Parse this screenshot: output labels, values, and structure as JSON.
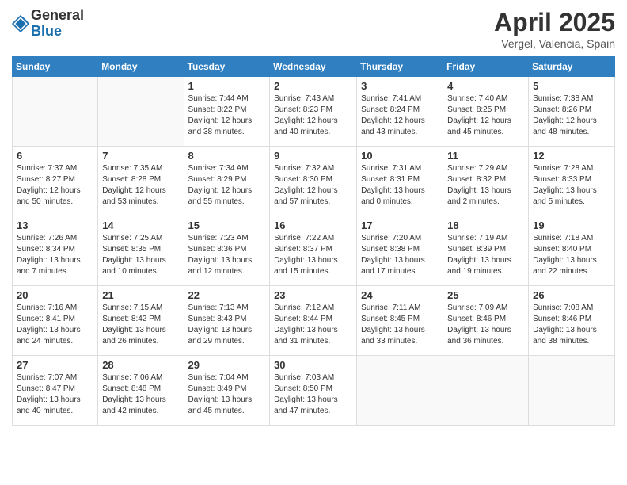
{
  "logo": {
    "general": "General",
    "blue": "Blue"
  },
  "title": "April 2025",
  "location": "Vergel, Valencia, Spain",
  "days_of_week": [
    "Sunday",
    "Monday",
    "Tuesday",
    "Wednesday",
    "Thursday",
    "Friday",
    "Saturday"
  ],
  "weeks": [
    [
      {
        "day": "",
        "info": ""
      },
      {
        "day": "",
        "info": ""
      },
      {
        "day": "1",
        "info": "Sunrise: 7:44 AM\nSunset: 8:22 PM\nDaylight: 12 hours\nand 38 minutes."
      },
      {
        "day": "2",
        "info": "Sunrise: 7:43 AM\nSunset: 8:23 PM\nDaylight: 12 hours\nand 40 minutes."
      },
      {
        "day": "3",
        "info": "Sunrise: 7:41 AM\nSunset: 8:24 PM\nDaylight: 12 hours\nand 43 minutes."
      },
      {
        "day": "4",
        "info": "Sunrise: 7:40 AM\nSunset: 8:25 PM\nDaylight: 12 hours\nand 45 minutes."
      },
      {
        "day": "5",
        "info": "Sunrise: 7:38 AM\nSunset: 8:26 PM\nDaylight: 12 hours\nand 48 minutes."
      }
    ],
    [
      {
        "day": "6",
        "info": "Sunrise: 7:37 AM\nSunset: 8:27 PM\nDaylight: 12 hours\nand 50 minutes."
      },
      {
        "day": "7",
        "info": "Sunrise: 7:35 AM\nSunset: 8:28 PM\nDaylight: 12 hours\nand 53 minutes."
      },
      {
        "day": "8",
        "info": "Sunrise: 7:34 AM\nSunset: 8:29 PM\nDaylight: 12 hours\nand 55 minutes."
      },
      {
        "day": "9",
        "info": "Sunrise: 7:32 AM\nSunset: 8:30 PM\nDaylight: 12 hours\nand 57 minutes."
      },
      {
        "day": "10",
        "info": "Sunrise: 7:31 AM\nSunset: 8:31 PM\nDaylight: 13 hours\nand 0 minutes."
      },
      {
        "day": "11",
        "info": "Sunrise: 7:29 AM\nSunset: 8:32 PM\nDaylight: 13 hours\nand 2 minutes."
      },
      {
        "day": "12",
        "info": "Sunrise: 7:28 AM\nSunset: 8:33 PM\nDaylight: 13 hours\nand 5 minutes."
      }
    ],
    [
      {
        "day": "13",
        "info": "Sunrise: 7:26 AM\nSunset: 8:34 PM\nDaylight: 13 hours\nand 7 minutes."
      },
      {
        "day": "14",
        "info": "Sunrise: 7:25 AM\nSunset: 8:35 PM\nDaylight: 13 hours\nand 10 minutes."
      },
      {
        "day": "15",
        "info": "Sunrise: 7:23 AM\nSunset: 8:36 PM\nDaylight: 13 hours\nand 12 minutes."
      },
      {
        "day": "16",
        "info": "Sunrise: 7:22 AM\nSunset: 8:37 PM\nDaylight: 13 hours\nand 15 minutes."
      },
      {
        "day": "17",
        "info": "Sunrise: 7:20 AM\nSunset: 8:38 PM\nDaylight: 13 hours\nand 17 minutes."
      },
      {
        "day": "18",
        "info": "Sunrise: 7:19 AM\nSunset: 8:39 PM\nDaylight: 13 hours\nand 19 minutes."
      },
      {
        "day": "19",
        "info": "Sunrise: 7:18 AM\nSunset: 8:40 PM\nDaylight: 13 hours\nand 22 minutes."
      }
    ],
    [
      {
        "day": "20",
        "info": "Sunrise: 7:16 AM\nSunset: 8:41 PM\nDaylight: 13 hours\nand 24 minutes."
      },
      {
        "day": "21",
        "info": "Sunrise: 7:15 AM\nSunset: 8:42 PM\nDaylight: 13 hours\nand 26 minutes."
      },
      {
        "day": "22",
        "info": "Sunrise: 7:13 AM\nSunset: 8:43 PM\nDaylight: 13 hours\nand 29 minutes."
      },
      {
        "day": "23",
        "info": "Sunrise: 7:12 AM\nSunset: 8:44 PM\nDaylight: 13 hours\nand 31 minutes."
      },
      {
        "day": "24",
        "info": "Sunrise: 7:11 AM\nSunset: 8:45 PM\nDaylight: 13 hours\nand 33 minutes."
      },
      {
        "day": "25",
        "info": "Sunrise: 7:09 AM\nSunset: 8:46 PM\nDaylight: 13 hours\nand 36 minutes."
      },
      {
        "day": "26",
        "info": "Sunrise: 7:08 AM\nSunset: 8:46 PM\nDaylight: 13 hours\nand 38 minutes."
      }
    ],
    [
      {
        "day": "27",
        "info": "Sunrise: 7:07 AM\nSunset: 8:47 PM\nDaylight: 13 hours\nand 40 minutes."
      },
      {
        "day": "28",
        "info": "Sunrise: 7:06 AM\nSunset: 8:48 PM\nDaylight: 13 hours\nand 42 minutes."
      },
      {
        "day": "29",
        "info": "Sunrise: 7:04 AM\nSunset: 8:49 PM\nDaylight: 13 hours\nand 45 minutes."
      },
      {
        "day": "30",
        "info": "Sunrise: 7:03 AM\nSunset: 8:50 PM\nDaylight: 13 hours\nand 47 minutes."
      },
      {
        "day": "",
        "info": ""
      },
      {
        "day": "",
        "info": ""
      },
      {
        "day": "",
        "info": ""
      }
    ]
  ]
}
